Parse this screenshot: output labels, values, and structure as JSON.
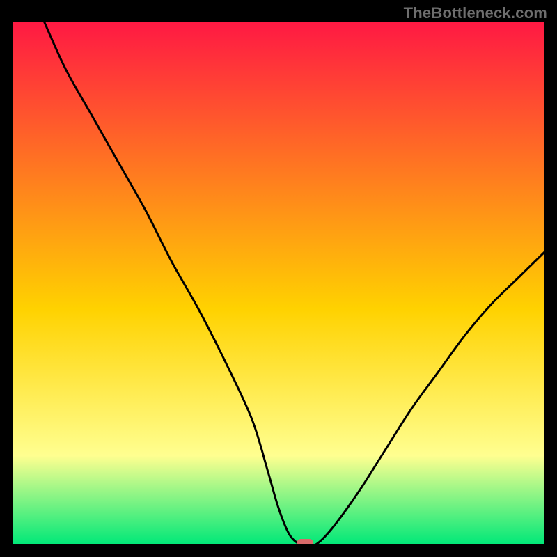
{
  "watermark": "TheBottleneck.com",
  "chart_data": {
    "type": "line",
    "title": "",
    "xlabel": "",
    "ylabel": "",
    "xlim": [
      0,
      100
    ],
    "ylim": [
      0,
      100
    ],
    "grid": false,
    "legend": false,
    "background_gradient": {
      "top": "#ff1943",
      "mid": "#ffd200",
      "low": "#ffff90",
      "bottom": "#00e878"
    },
    "series": [
      {
        "name": "bottleneck-curve",
        "color": "#000000",
        "x": [
          6,
          10,
          15,
          20,
          25,
          30,
          35,
          40,
          45,
          48,
          50,
          52,
          54,
          55,
          57,
          60,
          65,
          70,
          75,
          80,
          85,
          90,
          95,
          100
        ],
        "y": [
          100,
          91,
          82,
          73,
          64,
          54,
          45,
          35,
          24,
          14,
          7,
          2,
          0,
          0,
          0,
          3,
          10,
          18,
          26,
          33,
          40,
          46,
          51,
          56
        ]
      }
    ],
    "marker": {
      "name": "optimal-point",
      "x": 55,
      "y": 0,
      "color": "#d86a6a",
      "shape": "rounded-rect"
    }
  }
}
